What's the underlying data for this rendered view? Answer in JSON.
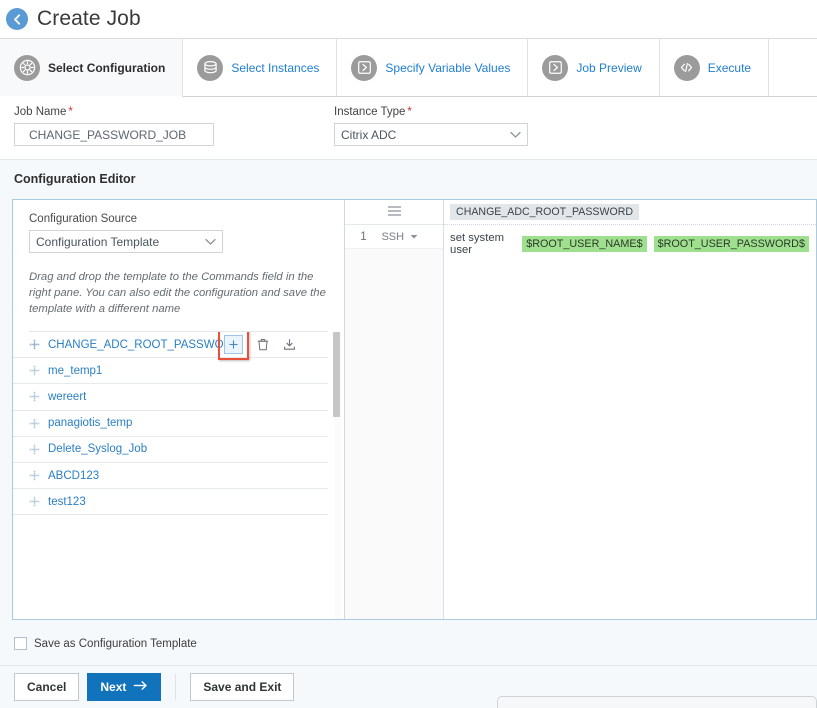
{
  "header": {
    "back_icon": "arrow-left-circle-icon",
    "title": "Create Job"
  },
  "tabs": [
    {
      "label": "Select Configuration",
      "icon": "gear-icon",
      "active": true
    },
    {
      "label": "Select Instances",
      "icon": "stack-icon",
      "active": false
    },
    {
      "label": "Specify Variable Values",
      "icon": "play-icon",
      "active": false
    },
    {
      "label": "Job Preview",
      "icon": "play-icon",
      "active": false
    },
    {
      "label": "Execute",
      "icon": "code-icon",
      "active": false
    }
  ],
  "form": {
    "job_name": {
      "label": "Job Name",
      "required_mark": "*",
      "value": "CHANGE_PASSWORD_JOB",
      "placeholder": "Job Name"
    },
    "instance_type": {
      "label": "Instance Type",
      "required_mark": "*",
      "value": "Citrix ADC",
      "options": [
        "Citrix ADC"
      ]
    }
  },
  "configuration_editor": {
    "title": "Configuration Editor",
    "source": {
      "label": "Configuration Source",
      "value": "Configuration Template",
      "options": [
        "Configuration Template"
      ]
    },
    "hint": "Drag and drop the template to the Commands field in the right pane. You can also edit the configuration and save the template with a different name",
    "templates": [
      {
        "name": "CHANGE_ADC_ROOT_PASSWORD",
        "has_actions": true,
        "highlighted": true
      },
      {
        "name": "me_temp1",
        "has_actions": false,
        "highlighted": false
      },
      {
        "name": "wereert",
        "has_actions": false,
        "highlighted": false
      },
      {
        "name": "panagiotis_temp",
        "has_actions": false,
        "highlighted": false
      },
      {
        "name": "Delete_Syslog_Job",
        "has_actions": false,
        "highlighted": false
      },
      {
        "name": "ABCD123",
        "has_actions": false,
        "highlighted": false
      },
      {
        "name": "test123",
        "has_actions": false,
        "highlighted": false
      }
    ],
    "template_actions": {
      "add": "plus-icon",
      "delete": "trash-icon",
      "download": "download-icon"
    },
    "gutter": {
      "menu_icon": "hamburger-icon",
      "line_number": "1",
      "protocol": "SSH",
      "protocol_caret": "caret-down-icon"
    },
    "commands": {
      "tag": "CHANGE_ADC_ROOT_PASSWORD",
      "text": "set system user",
      "variables": [
        "$ROOT_USER_NAME$",
        "$ROOT_USER_PASSWORD$"
      ]
    }
  },
  "save_template": {
    "label": "Save as Configuration Template",
    "checked": false
  },
  "footer": {
    "cancel": "Cancel",
    "next": "Next",
    "next_icon": "arrow-right-icon",
    "save_and_exit": "Save and Exit"
  },
  "colors": {
    "accent_blue": "#1273bd",
    "link_blue": "#2a7fc4",
    "variable_green": "#9fe08f",
    "highlight_red": "#e8503a",
    "panel_bg": "#f6f9fb"
  }
}
